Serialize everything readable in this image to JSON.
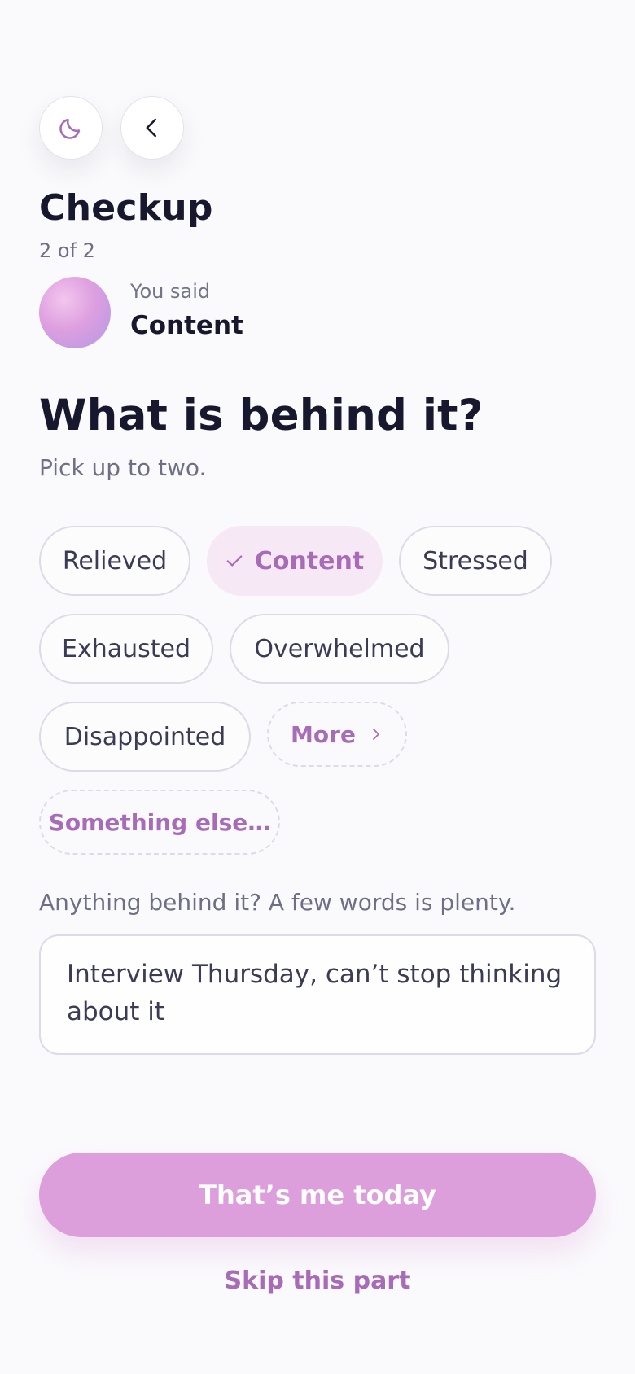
{
  "header": {
    "theme_icon": "moon-icon",
    "back_icon": "chevron-left-icon",
    "title": "Checkup",
    "step": "2 of 2"
  },
  "previous_answer": {
    "label": "You said",
    "value": "Content"
  },
  "question": {
    "title": "What is behind it?",
    "hint": "Pick up to two."
  },
  "chips": [
    {
      "label": "Relieved",
      "selected": false
    },
    {
      "label": "Content",
      "selected": true
    },
    {
      "label": "Stressed",
      "selected": false
    },
    {
      "label": "Exhausted",
      "selected": false
    },
    {
      "label": "Overwhelmed",
      "selected": false
    },
    {
      "label": "Disappointed",
      "selected": false
    }
  ],
  "more_chip": {
    "label": "More",
    "icon": "chevron-right-icon"
  },
  "other_chip": {
    "label": "Something else…"
  },
  "note": {
    "label": "Anything behind it? A few words is plenty.",
    "value": "Interview Thursday, can’t stop thinking about it"
  },
  "actions": {
    "primary_label": "That’s me today",
    "skip_label": "Skip this part"
  },
  "colors": {
    "accent": "#a86bb8",
    "primary_button": "#dc9fdb",
    "selected_chip_bg": "#f7e8f6",
    "title": "#17172e"
  }
}
